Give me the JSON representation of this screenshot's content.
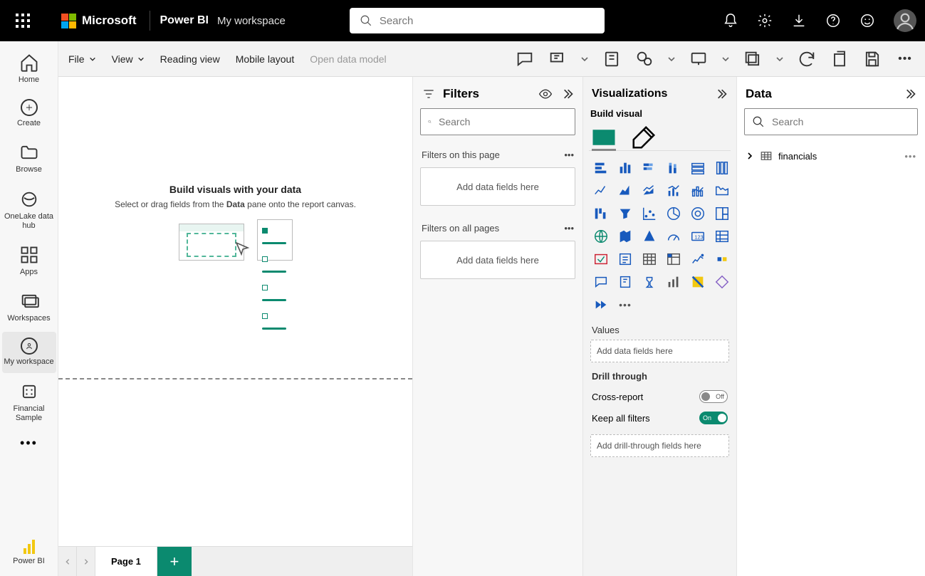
{
  "header": {
    "brand": "Microsoft",
    "product": "Power BI",
    "workspace": "My workspace",
    "search_placeholder": "Search"
  },
  "sidebar": {
    "items": [
      {
        "label": "Home"
      },
      {
        "label": "Create"
      },
      {
        "label": "Browse"
      },
      {
        "label": "OneLake data hub"
      },
      {
        "label": "Apps"
      },
      {
        "label": "Workspaces"
      },
      {
        "label": "My workspace"
      },
      {
        "label": "Financial Sample"
      }
    ],
    "bottom_label": "Power BI"
  },
  "menubar": {
    "file": "File",
    "view": "View",
    "reading": "Reading view",
    "mobile": "Mobile layout",
    "open_model": "Open data model"
  },
  "canvas": {
    "title": "Build visuals with your data",
    "subtitle_pre": "Select or drag fields from the ",
    "subtitle_bold": "Data",
    "subtitle_post": " pane onto the report canvas.",
    "page_tab": "Page 1"
  },
  "filters": {
    "title": "Filters",
    "search_placeholder": "Search",
    "on_page": "Filters on this page",
    "on_all": "Filters on all pages",
    "add_hint": "Add data fields here"
  },
  "viz": {
    "title": "Visualizations",
    "subtitle": "Build visual",
    "values": "Values",
    "values_hint": "Add data fields here",
    "drill": "Drill through",
    "cross": "Cross-report",
    "cross_state": "Off",
    "keep": "Keep all filters",
    "keep_state": "On",
    "drill_hint": "Add drill-through fields here"
  },
  "data": {
    "title": "Data",
    "search_placeholder": "Search",
    "tables": [
      {
        "name": "financials"
      }
    ]
  }
}
